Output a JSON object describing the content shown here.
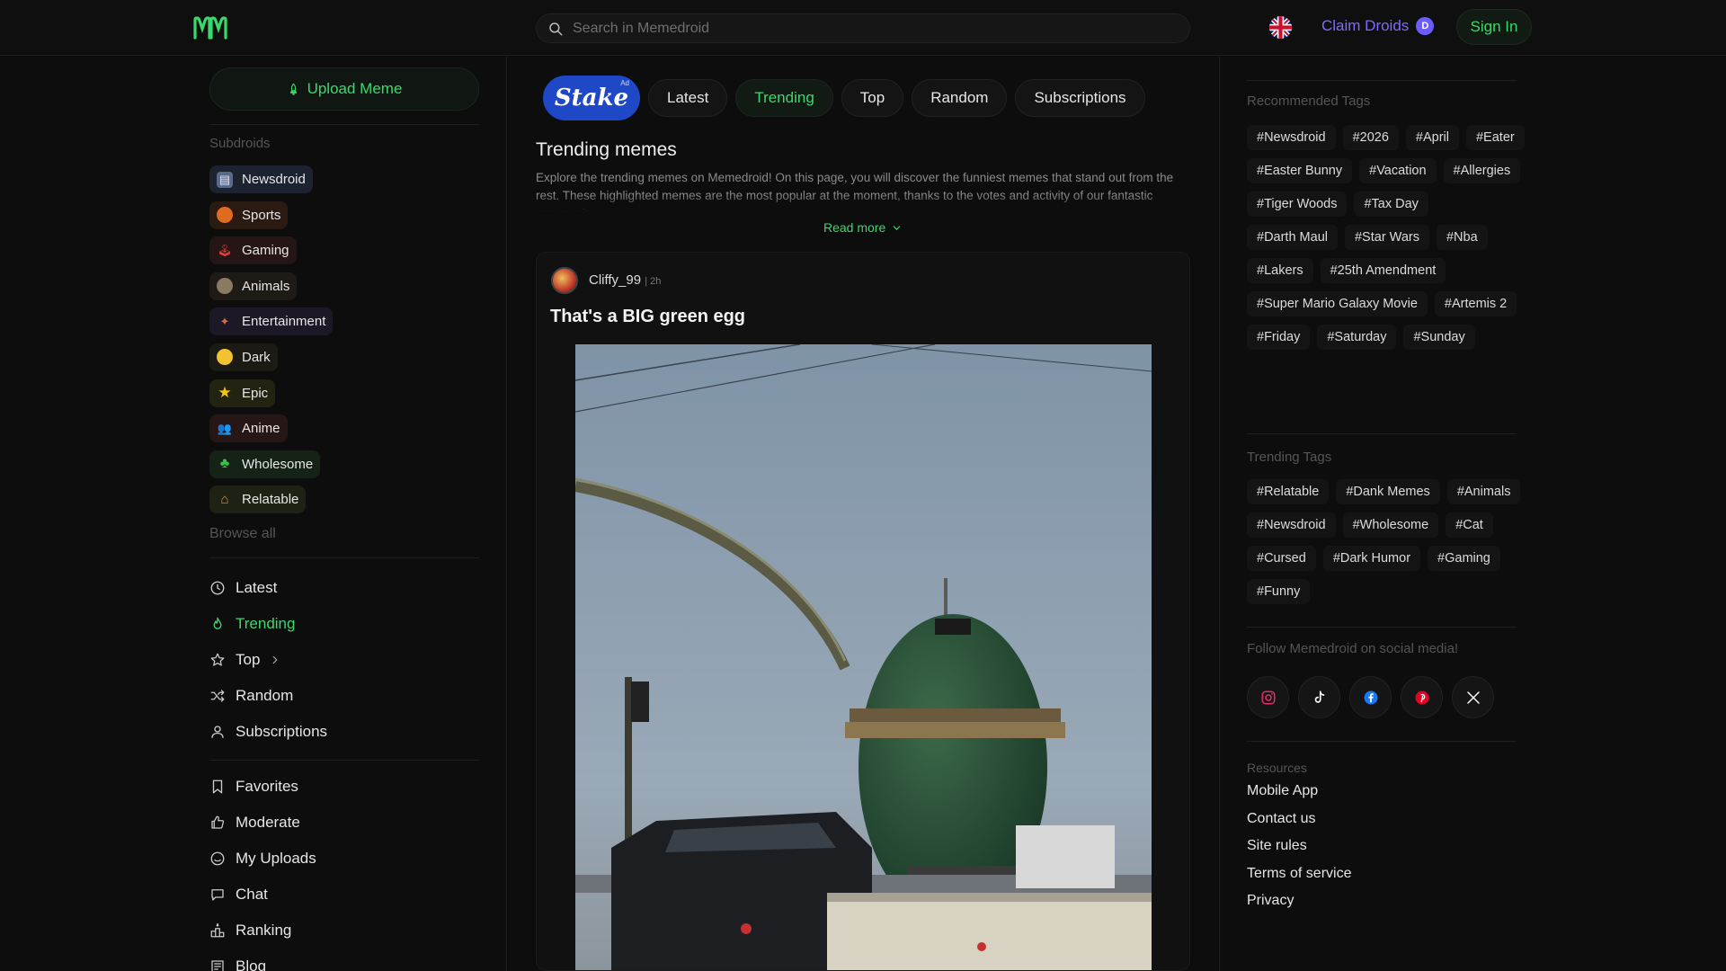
{
  "header": {
    "search_placeholder": "Search in Memedroid",
    "claim_label": "Claim Droids",
    "signin_label": "Sign In"
  },
  "sidebar": {
    "upload_label": "Upload Meme",
    "subdroids_label": "Subdroids",
    "subdroids": [
      {
        "label": "Newsdroid",
        "icon": "newspaper-icon",
        "bg": "#1c2230"
      },
      {
        "label": "Sports",
        "icon": "basketball-icon",
        "bg": "#2a1a12"
      },
      {
        "label": "Gaming",
        "icon": "joystick-icon",
        "bg": "#261515"
      },
      {
        "label": "Animals",
        "icon": "sloth-icon",
        "bg": "#1e1b16"
      },
      {
        "label": "Entertainment",
        "icon": "clapper-icon",
        "bg": "#1c1826"
      },
      {
        "label": "Dark",
        "icon": "scream-icon",
        "bg": "#1c1a14"
      },
      {
        "label": "Epic",
        "icon": "star-icon",
        "bg": "#232312"
      },
      {
        "label": "Anime",
        "icon": "anime-people-icon",
        "bg": "#261616"
      },
      {
        "label": "Wholesome",
        "icon": "clover-icon",
        "bg": "#142316"
      },
      {
        "label": "Relatable",
        "icon": "house-icon",
        "bg": "#1d2214"
      }
    ],
    "browse_all_label": "Browse all",
    "nav_primary": [
      {
        "label": "Latest",
        "icon": "clock-icon",
        "active": false
      },
      {
        "label": "Trending",
        "icon": "flame-icon",
        "active": true
      },
      {
        "label": "Top",
        "icon": "star-outline-icon",
        "active": false
      },
      {
        "label": "Random",
        "icon": "shuffle-icon",
        "active": false
      },
      {
        "label": "Subscriptions",
        "icon": "user-icon",
        "active": false
      }
    ],
    "nav_secondary": [
      {
        "label": "Favorites",
        "icon": "bookmark-icon"
      },
      {
        "label": "Moderate",
        "icon": "thumbs-up-icon"
      },
      {
        "label": "My Uploads",
        "icon": "smile-icon"
      },
      {
        "label": "Chat",
        "icon": "chat-icon"
      },
      {
        "label": "Ranking",
        "icon": "podium-icon"
      },
      {
        "label": "Blog",
        "icon": "newspaper-outline-icon"
      }
    ]
  },
  "main": {
    "ad_label": "Stake",
    "ad_badge": "Ad",
    "tabs": [
      {
        "label": "Latest",
        "active": false
      },
      {
        "label": "Trending",
        "active": true
      },
      {
        "label": "Top",
        "active": false
      },
      {
        "label": "Random",
        "active": false
      },
      {
        "label": "Subscriptions",
        "active": false
      }
    ],
    "title": "Trending memes",
    "description": "Explore the trending memes on Memedroid! On this page, you will discover the funniest memes that stand out from the rest. These highlighted memes are the most popular at the moment, thanks to the votes and activity of our fantastic community.",
    "read_more": "Read more",
    "post": {
      "author": "Cliffy_99",
      "time": "| 2h",
      "title": "That's a BIG green egg"
    }
  },
  "right": {
    "recommended_label": "Recommended Tags",
    "recommended_tags": [
      "#Newsdroid",
      "#2026",
      "#April",
      "#Eater",
      "#Easter Bunny",
      "#Vacation",
      "#Allergies",
      "#Tiger Woods",
      "#Tax Day",
      "#Darth Maul",
      "#Star Wars",
      "#Nba",
      "#Lakers",
      "#25th Amendment",
      "#Super Mario Galaxy Movie",
      "#Artemis 2",
      "#Friday",
      "#Saturday",
      "#Sunday"
    ],
    "trending_label": "Trending Tags",
    "trending_tags": [
      "#Relatable",
      "#Dank Memes",
      "#Animals",
      "#Newsdroid",
      "#Wholesome",
      "#Cat",
      "#Cursed",
      "#Dark Humor",
      "#Gaming",
      "#Funny"
    ],
    "follow_label": "Follow Memedroid on social media!",
    "social": [
      "instagram-icon",
      "tiktok-icon",
      "facebook-icon",
      "pinterest-icon",
      "x-icon"
    ],
    "resources_label": "Resources",
    "resources": [
      "Mobile App",
      "Contact us",
      "Site rules",
      "Terms of service",
      "Privacy"
    ]
  },
  "colors": {
    "accent": "#3ad96b",
    "claim": "#7c6bff",
    "stake": "#1f48c7",
    "background": "#0d0d0d"
  }
}
